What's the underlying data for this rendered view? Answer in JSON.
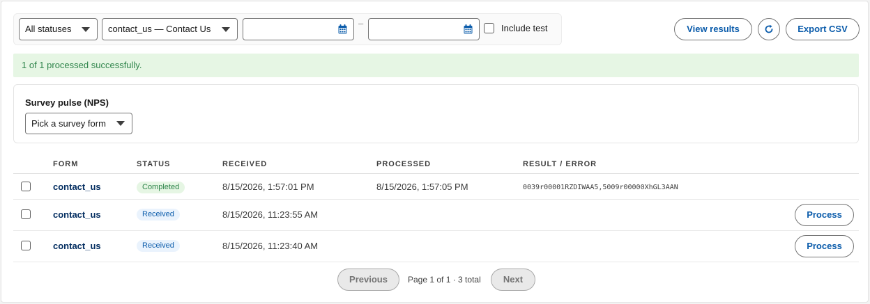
{
  "filters": {
    "status_select": "All statuses",
    "form_select": "contact_us — Contact Us",
    "date_from_value": "",
    "date_to_value": "",
    "date_separator": "–",
    "include_test_label": "Include test",
    "include_test_checked": false
  },
  "actions": {
    "view_results": "View results",
    "refresh": "refresh-icon",
    "export_csv": "Export CSV"
  },
  "banner": {
    "message": "1 of 1 processed successfully."
  },
  "survey": {
    "title": "Survey pulse (NPS)",
    "select": "Pick a survey form"
  },
  "table": {
    "columns": [
      "FORM",
      "STATUS",
      "RECEIVED",
      "PROCESSED",
      "RESULT / ERROR"
    ],
    "rows": [
      {
        "form": "contact_us",
        "status": "Completed",
        "received": "8/15/2026, 1:57:01 PM",
        "processed": "8/15/2026, 1:57:05 PM",
        "result": "0039r00001RZDIWAA5,5009r00000XhGL3AAN",
        "action": ""
      },
      {
        "form": "contact_us",
        "status": "Received",
        "received": "8/15/2026, 11:23:55 AM",
        "processed": "",
        "result": "",
        "action": "Process"
      },
      {
        "form": "contact_us",
        "status": "Received",
        "received": "8/15/2026, 11:23:40 AM",
        "processed": "",
        "result": "",
        "action": "Process"
      }
    ]
  },
  "pagination": {
    "previous": "Previous",
    "info": "Page 1 of 1 · 3 total",
    "next": "Next"
  },
  "colors": {
    "brand_blue": "#0b5cab",
    "success_bg": "#e6f6e4",
    "success_text": "#2e844a"
  }
}
